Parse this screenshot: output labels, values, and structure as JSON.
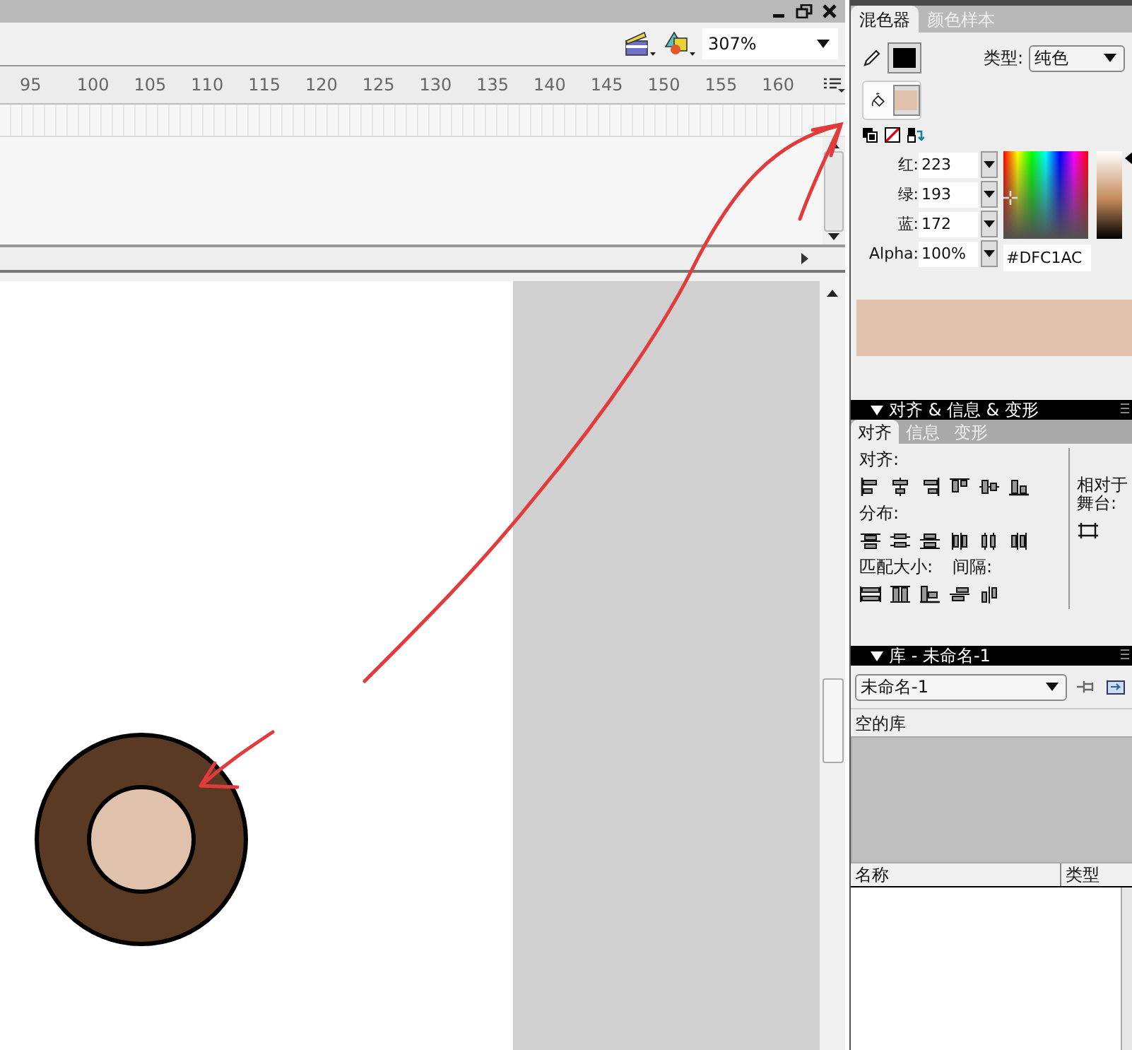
{
  "toolbar": {
    "zoom": "307%"
  },
  "timeline": {
    "ruler": [
      "95",
      "100",
      "105",
      "110",
      "115",
      "120",
      "125",
      "130",
      "135",
      "140",
      "145",
      "150",
      "155",
      "160"
    ]
  },
  "mixer": {
    "tabs": [
      {
        "label": "混色器",
        "selected": true
      },
      {
        "label": "颜色样本",
        "selected": false
      }
    ],
    "stroke": {
      "color": "#000000"
    },
    "fill": {
      "color": "#dfc1ac"
    },
    "type_label": "类型:",
    "type_value": "纯色",
    "channels": [
      {
        "label": "红:",
        "value": "223"
      },
      {
        "label": "绿:",
        "value": "193"
      },
      {
        "label": "蓝:",
        "value": "172"
      },
      {
        "label": "Alpha:",
        "value": "100%"
      }
    ],
    "hex": "#DFC1AC"
  },
  "align_panel": {
    "title": "对齐 & 信息 & 变形",
    "tabs": [
      {
        "label": "对齐",
        "selected": true
      },
      {
        "label": "信息",
        "selected": false
      },
      {
        "label": "变形",
        "selected": false
      }
    ],
    "align_label": "对齐:",
    "distribute_label": "分布:",
    "match_label": "匹配大小:",
    "spacing_label": "间隔:",
    "stage_label": "相对于舞台:"
  },
  "library": {
    "title": "库 - 未命名-1",
    "document": "未命名-1",
    "status": "空的库",
    "columns": [
      "名称",
      "类型"
    ]
  }
}
